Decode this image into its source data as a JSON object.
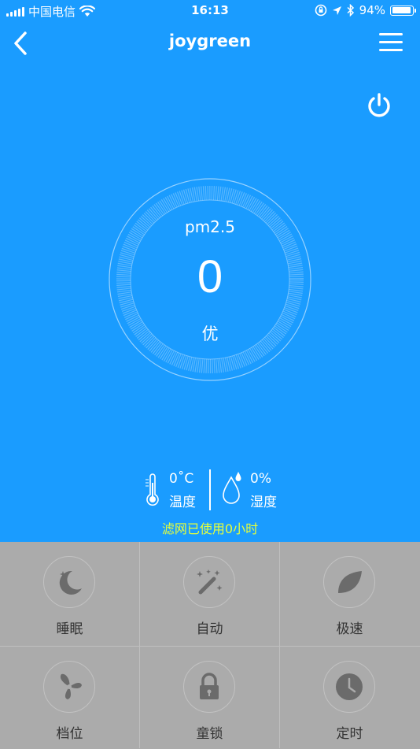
{
  "status_bar": {
    "carrier": "中国电信",
    "time": "16:13",
    "battery_percent": "94%",
    "battery_level": 0.94
  },
  "nav": {
    "title": "joygreen",
    "back_icon": "chevron-left-icon",
    "menu_icon": "hamburger-menu-icon",
    "power_icon": "power-icon"
  },
  "gauge": {
    "label": "pm2.5",
    "value": "0",
    "quality": "优"
  },
  "environment": {
    "temperature_value": "0˚C",
    "temperature_label": "温度",
    "humidity_value": "0%",
    "humidity_label": "湿度"
  },
  "filter_status": "滤网已使用0小时",
  "modes": [
    {
      "label": "睡眠",
      "icon": "moon-icon"
    },
    {
      "label": "自动",
      "icon": "magic-wand-icon"
    },
    {
      "label": "极速",
      "icon": "leaf-icon"
    },
    {
      "label": "档位",
      "icon": "fan-icon"
    },
    {
      "label": "童锁",
      "icon": "lock-icon"
    },
    {
      "label": "定时",
      "icon": "clock-icon"
    }
  ],
  "colors": {
    "primary": "#1a9cff",
    "panel": "#ababab",
    "filter_text": "#e6ff3a",
    "icon_gray": "#6b6b6b"
  }
}
